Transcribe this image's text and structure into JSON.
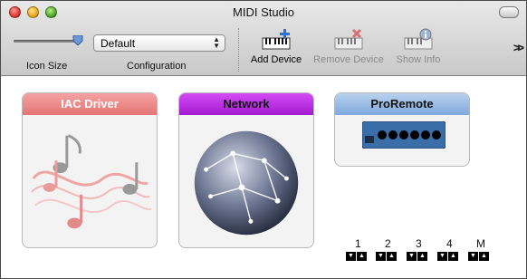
{
  "window": {
    "title": "MIDI Studio"
  },
  "toolbar": {
    "icon_size_label": "Icon Size",
    "icon_size_value": 0.9,
    "configuration_label": "Configuration",
    "configuration_value": "Default",
    "add_device_label": "Add Device",
    "remove_device_label": "Remove Device",
    "show_info_label": "Show Info",
    "overflow_label": ">>"
  },
  "devices": [
    {
      "name": "IAC Driver"
    },
    {
      "name": "Network"
    },
    {
      "name": "ProRemote",
      "ports": [
        "1",
        "2",
        "3",
        "4",
        "M"
      ]
    }
  ]
}
